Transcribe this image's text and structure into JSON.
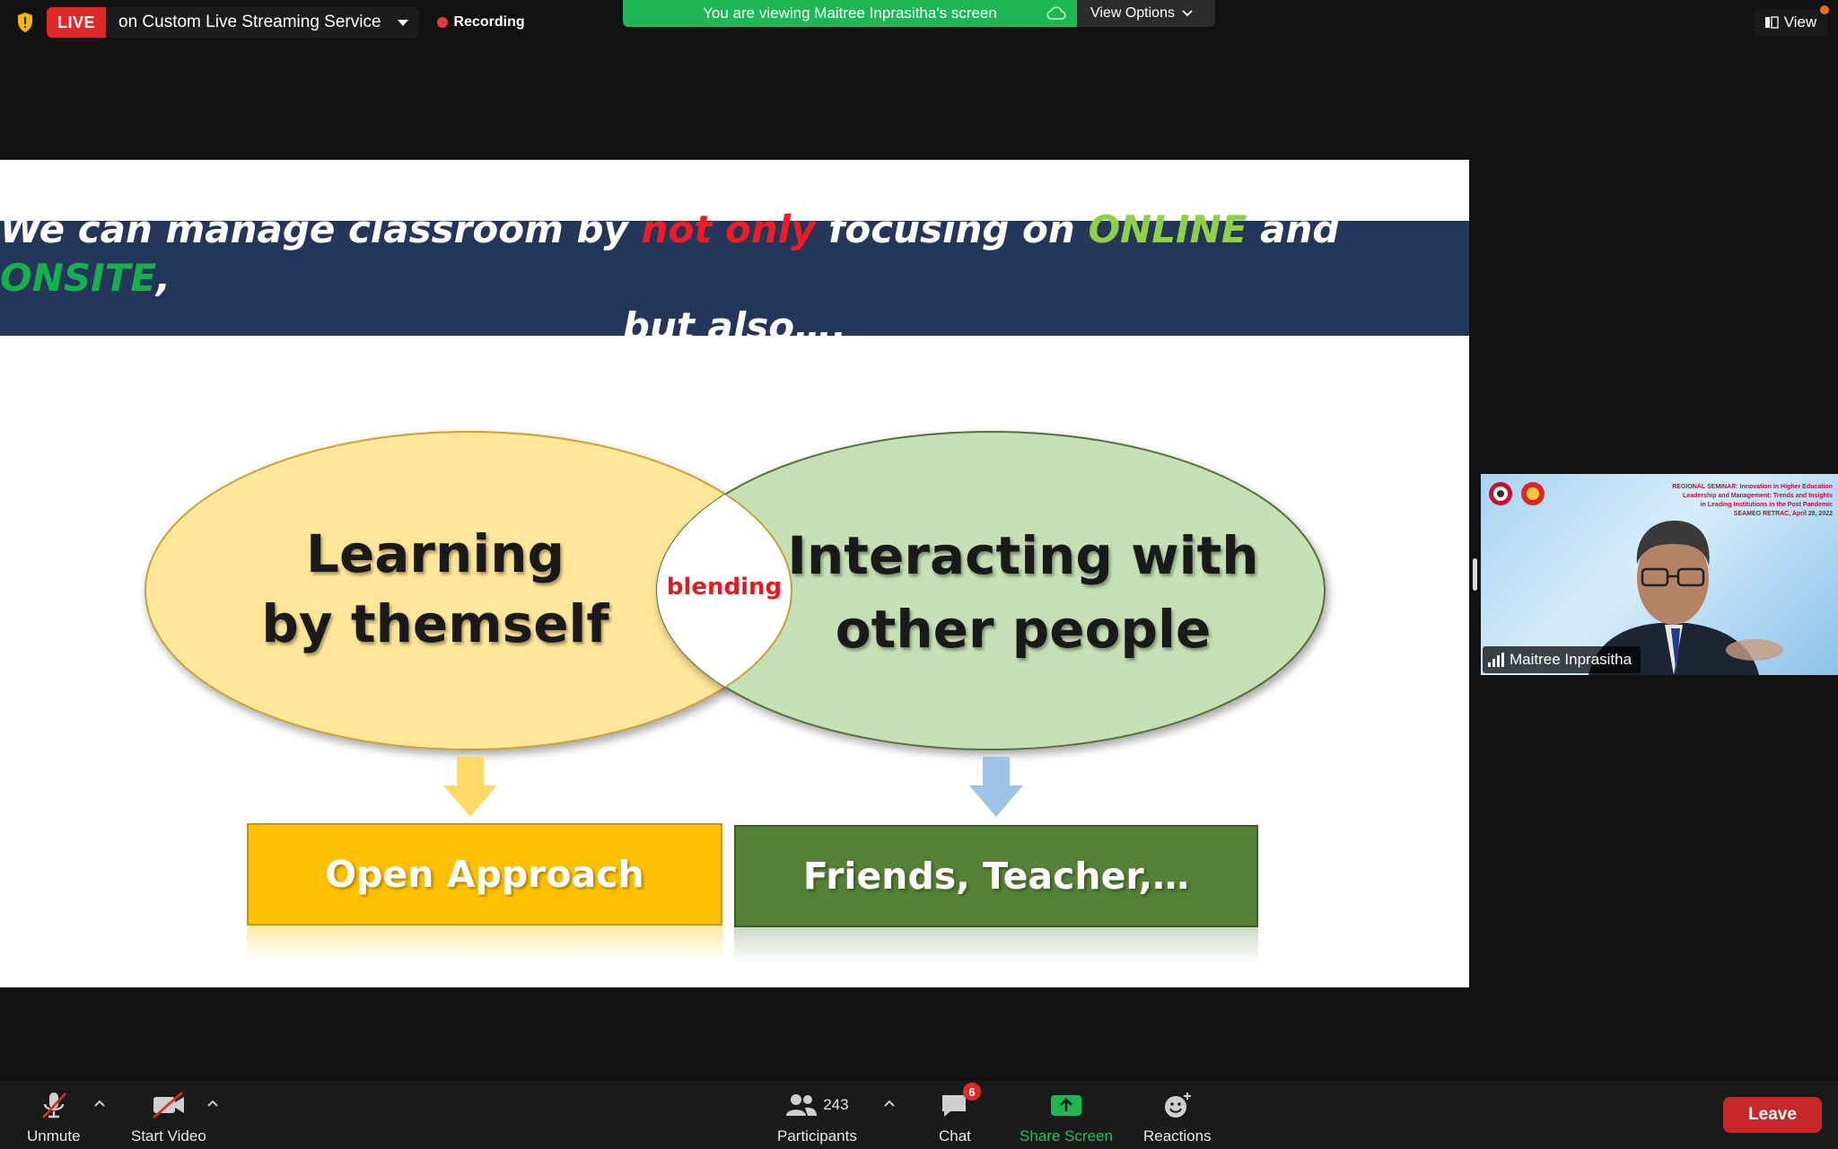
{
  "topbar": {
    "live_badge": "LIVE",
    "live_service": "on Custom Live Streaming Service",
    "recording": "Recording",
    "viewing_banner": "You are viewing Maitree Inprasitha's screen",
    "view_options": "View Options",
    "view_button": "View",
    "colors": {
      "live": "#e02828",
      "viewing_bg": "#1fb655",
      "recording_dot": "#e53b3b"
    }
  },
  "slide": {
    "banner_line1_parts": [
      "We can manage classroom by ",
      "not only",
      " focusing on ",
      "ONLINE",
      " and ",
      "ONSITE",
      ","
    ],
    "banner_line2": "but also….",
    "left_circle_line1": "Learning",
    "left_circle_line2": "by themself",
    "right_circle_line1": "Interacting with",
    "right_circle_line2": "other people",
    "overlap_label": "blending",
    "left_box": "Open Approach",
    "right_box": "Friends, Teacher,…",
    "colors": {
      "banner": "#243659",
      "left_circle": "#ffe699",
      "right_circle": "#c5e0b4",
      "left_box": "#fec000",
      "right_box": "#548135",
      "highlight_red": "#ee1c25",
      "online_green": "#8ed047",
      "onsite_green": "#17b04f"
    }
  },
  "participant_tile": {
    "name": "Maitree Inprasitha",
    "bg_line1": "REGIONAL SEMINAR: Innovation in Higher Education",
    "bg_line2": "Leadership and Management: Trends and Insights",
    "bg_line3": "in Leading Institutions in the Post Pandemic",
    "bg_line4": "SEAMEO RETRAC, April 28, 2022"
  },
  "toolbar": {
    "unmute": "Unmute",
    "start_video": "Start Video",
    "participants": "Participants",
    "participants_count": "243",
    "chat": "Chat",
    "chat_badge": "6",
    "share_screen": "Share Screen",
    "reactions": "Reactions",
    "leave": "Leave"
  }
}
